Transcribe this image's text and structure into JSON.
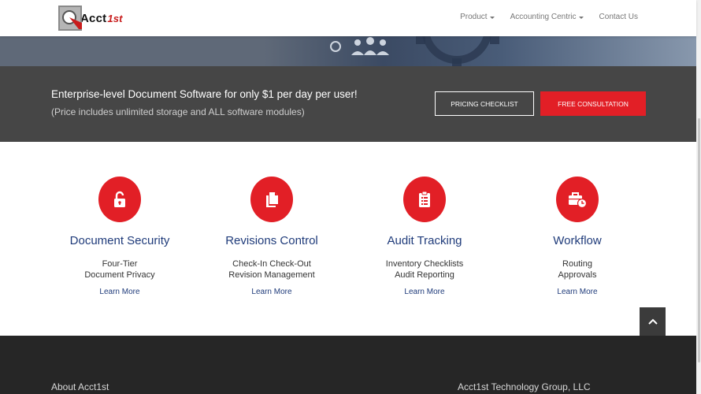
{
  "header": {
    "logo_text": "Acct",
    "logo_sup": "1st",
    "nav": [
      {
        "label": "Product",
        "has_caret": true
      },
      {
        "label": "Accounting Centric",
        "has_caret": true
      },
      {
        "label": "Contact Us",
        "has_caret": false
      }
    ]
  },
  "banner": {
    "title": "Enterprise-level Document Software for only $1 per day per user!",
    "subtitle": "(Price includes unlimited storage and ALL software modules)",
    "pricing_button": "PRICING CHECKLIST",
    "consult_button": "FREE CONSULTATION"
  },
  "features": [
    {
      "icon": "unlock-icon",
      "title": "Document Security",
      "lines": [
        "Four-Tier",
        "Document Privacy"
      ],
      "link": "Learn More"
    },
    {
      "icon": "copy-icon",
      "title": "Revisions Control",
      "lines": [
        "Check-In Check-Out",
        "Revision Management"
      ],
      "link": "Learn More"
    },
    {
      "icon": "clipboard-icon",
      "title": "Audit Tracking",
      "lines": [
        "Inventory Checklists",
        "Audit Reporting"
      ],
      "link": "Learn More"
    },
    {
      "icon": "briefcase-clock-icon",
      "title": "Workflow",
      "lines": [
        "Routing",
        "Approvals"
      ],
      "link": "Learn More"
    }
  ],
  "footer": {
    "left_heading": "About Acct1st",
    "right_heading": "Acct1st Technology Group, LLC"
  },
  "colors": {
    "accent": "#e21f26",
    "title_blue": "#1f3b7a",
    "banner_bg": "#464646",
    "footer_bg": "#262626"
  }
}
